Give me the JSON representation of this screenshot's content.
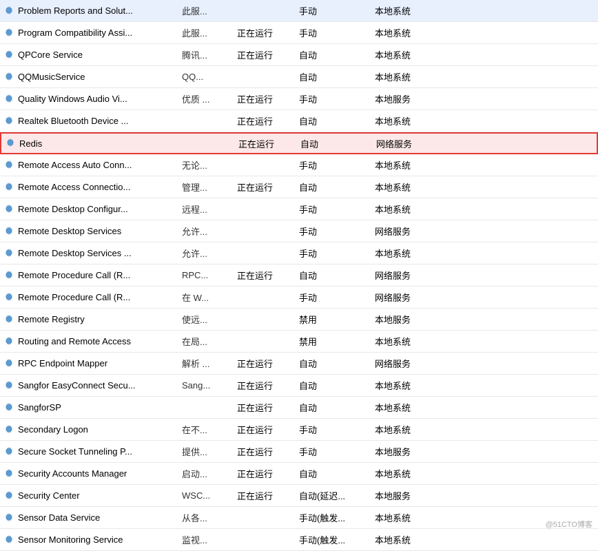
{
  "services": [
    {
      "name": "Problem Reports and Solut...",
      "desc": "此服...",
      "status": "",
      "startup": "手动",
      "logon": "本地系统",
      "highlighted": false
    },
    {
      "name": "Program Compatibility Assi...",
      "desc": "此服...",
      "status": "正在运行",
      "startup": "手动",
      "logon": "本地系统",
      "highlighted": false
    },
    {
      "name": "QPCore Service",
      "desc": "腾讯...",
      "status": "正在运行",
      "startup": "自动",
      "logon": "本地系统",
      "highlighted": false
    },
    {
      "name": "QQMusicService",
      "desc": "QQ...",
      "status": "",
      "startup": "自动",
      "logon": "本地系统",
      "highlighted": false
    },
    {
      "name": "Quality Windows Audio Vi...",
      "desc": "优质 ...",
      "status": "正在运行",
      "startup": "手动",
      "logon": "本地服务",
      "highlighted": false
    },
    {
      "name": "Realtek Bluetooth Device ...",
      "desc": "",
      "status": "正在运行",
      "startup": "自动",
      "logon": "本地系统",
      "highlighted": false
    },
    {
      "name": "Redis",
      "desc": "",
      "status": "正在运行",
      "startup": "自动",
      "logon": "网络服务",
      "highlighted": true
    },
    {
      "name": "Remote Access Auto Conn...",
      "desc": "无论...",
      "status": "",
      "startup": "手动",
      "logon": "本地系统",
      "highlighted": false
    },
    {
      "name": "Remote Access Connectio...",
      "desc": "管理...",
      "status": "正在运行",
      "startup": "自动",
      "logon": "本地系统",
      "highlighted": false
    },
    {
      "name": "Remote Desktop Configur...",
      "desc": "远程...",
      "status": "",
      "startup": "手动",
      "logon": "本地系统",
      "highlighted": false
    },
    {
      "name": "Remote Desktop Services",
      "desc": "允许...",
      "status": "",
      "startup": "手动",
      "logon": "网络服务",
      "highlighted": false
    },
    {
      "name": "Remote Desktop Services ...",
      "desc": "允许...",
      "status": "",
      "startup": "手动",
      "logon": "本地系统",
      "highlighted": false
    },
    {
      "name": "Remote Procedure Call (R...",
      "desc": "RPC...",
      "status": "正在运行",
      "startup": "自动",
      "logon": "网络服务",
      "highlighted": false
    },
    {
      "name": "Remote Procedure Call (R...",
      "desc": "在 W...",
      "status": "",
      "startup": "手动",
      "logon": "网络服务",
      "highlighted": false
    },
    {
      "name": "Remote Registry",
      "desc": "使远...",
      "status": "",
      "startup": "禁用",
      "logon": "本地服务",
      "highlighted": false
    },
    {
      "name": "Routing and Remote Access",
      "desc": "在局...",
      "status": "",
      "startup": "禁用",
      "logon": "本地系统",
      "highlighted": false
    },
    {
      "name": "RPC Endpoint Mapper",
      "desc": "解析 ...",
      "status": "正在运行",
      "startup": "自动",
      "logon": "网络服务",
      "highlighted": false
    },
    {
      "name": "Sangfor EasyConnect Secu...",
      "desc": "Sang...",
      "status": "正在运行",
      "startup": "自动",
      "logon": "本地系统",
      "highlighted": false
    },
    {
      "name": "SangforSP",
      "desc": "",
      "status": "正在运行",
      "startup": "自动",
      "logon": "本地系统",
      "highlighted": false
    },
    {
      "name": "Secondary Logon",
      "desc": "在不...",
      "status": "正在运行",
      "startup": "手动",
      "logon": "本地系统",
      "highlighted": false
    },
    {
      "name": "Secure Socket Tunneling P...",
      "desc": "提供...",
      "status": "正在运行",
      "startup": "手动",
      "logon": "本地服务",
      "highlighted": false
    },
    {
      "name": "Security Accounts Manager",
      "desc": "启动...",
      "status": "正在运行",
      "startup": "自动",
      "logon": "本地系统",
      "highlighted": false
    },
    {
      "name": "Security Center",
      "desc": "WSC...",
      "status": "正在运行",
      "startup": "自动(延迟...",
      "logon": "本地服务",
      "highlighted": false
    },
    {
      "name": "Sensor Data Service",
      "desc": "从各...",
      "status": "",
      "startup": "手动(触发...",
      "logon": "本地系统",
      "highlighted": false
    },
    {
      "name": "Sensor Monitoring Service",
      "desc": "监视...",
      "status": "",
      "startup": "手动(触发...",
      "logon": "本地系统",
      "highlighted": false
    }
  ],
  "watermark": "@51CTO博客"
}
